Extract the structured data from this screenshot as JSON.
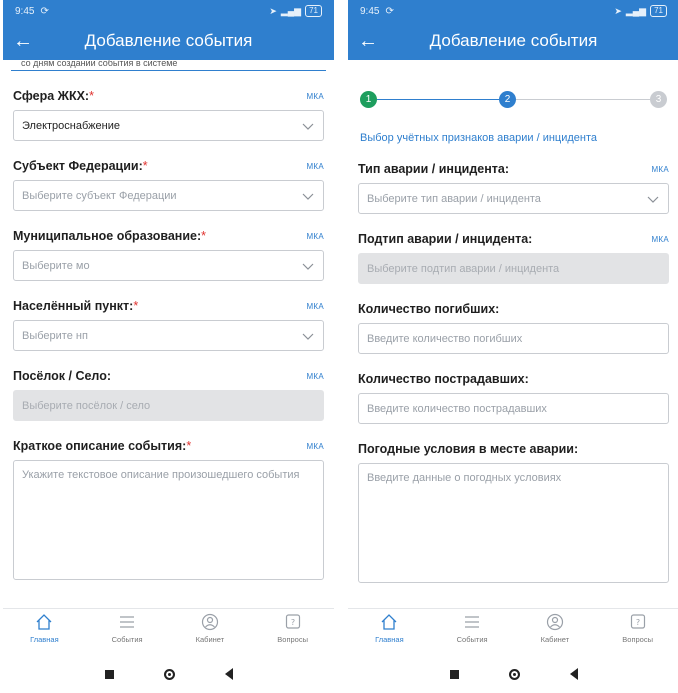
{
  "status_bar": {
    "time": "9:45",
    "battery": "71"
  },
  "app_bar": {
    "title": "Добавление события"
  },
  "left": {
    "cut_text": "со дням создании события в системе",
    "fields": [
      {
        "label": "Сфера ЖКХ:",
        "required": "*",
        "tag": "МКА",
        "value": "Электроснабжение"
      },
      {
        "label": "Субъект Федерации:",
        "required": "*",
        "tag": "МКА",
        "placeholder": "Выберите субъект Федерации"
      },
      {
        "label": "Муниципальное образование:",
        "required": "*",
        "tag": "МКА",
        "placeholder": "Выберите мо"
      },
      {
        "label": "Населённый пункт:",
        "required": "*",
        "tag": "МКА",
        "placeholder": "Выберите нп"
      },
      {
        "label": "Посёлок / Село:",
        "tag": "МКА",
        "placeholder": "Выберите посёлок / село"
      },
      {
        "label": "Краткое описание события:",
        "required": "*",
        "tag": "МКА",
        "placeholder": "Укажите текстовое описание произошедшего события"
      }
    ]
  },
  "right": {
    "steps": [
      "1",
      "2",
      "3"
    ],
    "section_title": "Выбор учётных признаков аварии / инцидента",
    "fields": [
      {
        "label": "Тип аварии / инцидента:",
        "tag": "МКА",
        "placeholder": "Выберите тип аварии / инцидента"
      },
      {
        "label": "Подтип аварии / инцидента:",
        "tag": "МКА",
        "placeholder": "Выберите подтип аварии / инцидента"
      },
      {
        "label": "Количество погибших:",
        "placeholder": "Введите количество погибших"
      },
      {
        "label": "Количество пострадавших:",
        "placeholder": "Введите количество пострадавших"
      },
      {
        "label": "Погодные условия в месте аварии:",
        "placeholder": "Введите данные о погодных условиях"
      }
    ]
  },
  "bottom_nav": [
    {
      "label": "Главная",
      "icon": "home-icon"
    },
    {
      "label": "События",
      "icon": "events-icon"
    },
    {
      "label": "Кабинет",
      "icon": "profile-icon"
    },
    {
      "label": "Вопросы",
      "icon": "questions-icon"
    }
  ],
  "colors": {
    "primary": "#2f7fce",
    "step_done": "#1e9e5e",
    "required": "#e0312e"
  }
}
